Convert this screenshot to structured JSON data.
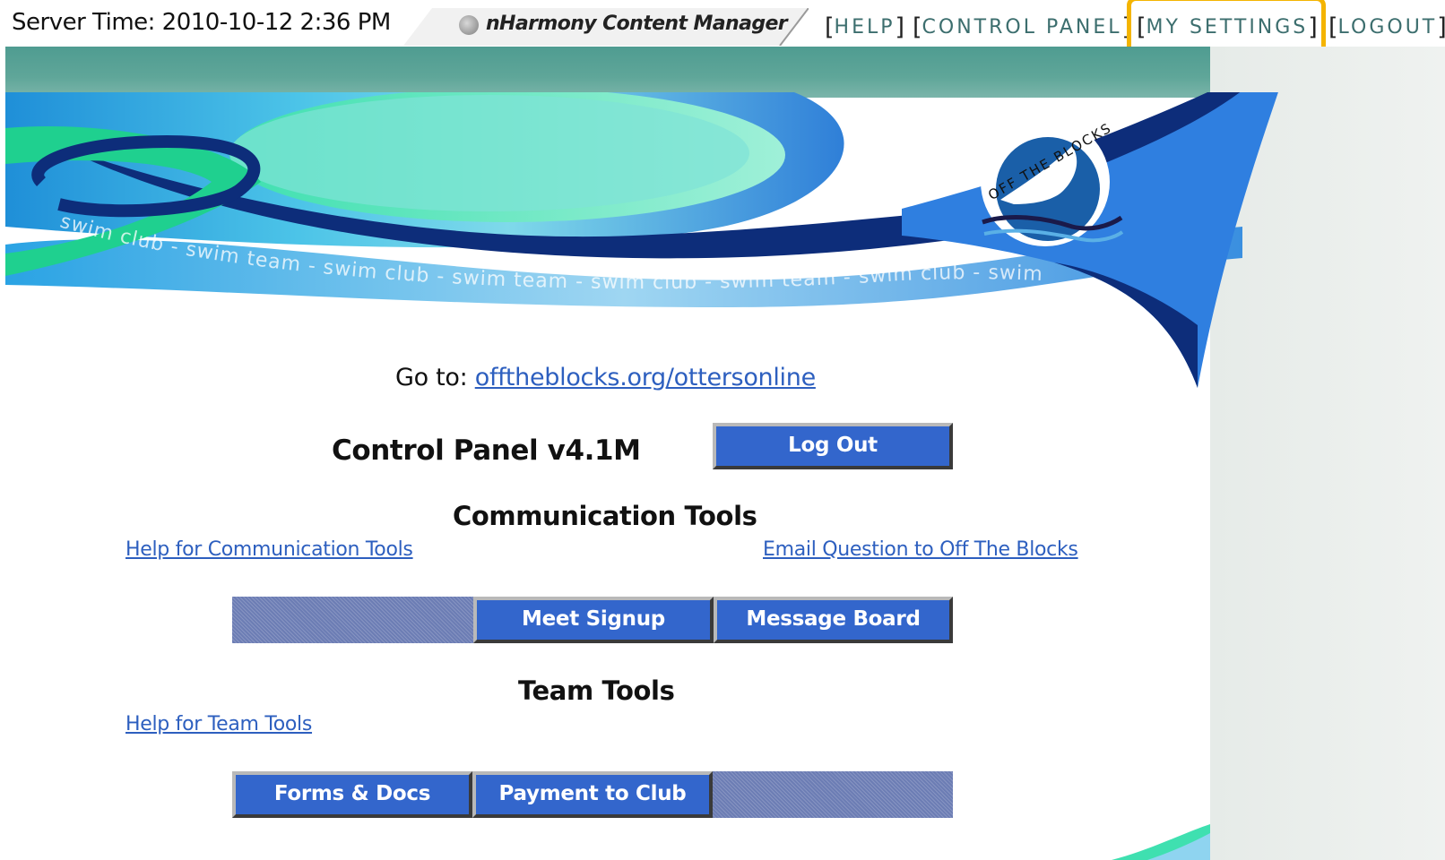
{
  "topbar": {
    "server_time": "Server Time: 2010-10-12 2:36 PM",
    "app_title": "nHarmony Content Manager",
    "nav": {
      "help": "HELP",
      "control_panel": "CONTROL PANEL",
      "my_settings": "MY SETTINGS",
      "logout": "LOGOUT"
    }
  },
  "banner": {
    "tagline_text": "swim club - swim team - swim club - swim team - swim club - swim team - swim club - swim",
    "logo_text": "OFF THE BLOCKS"
  },
  "main": {
    "goto_label": "Go to: ",
    "goto_link": "offtheblocks.org/ottersonline",
    "control_panel_title": "Control Panel v4.1M",
    "logout_button": "Log Out",
    "communication": {
      "heading": "Communication Tools",
      "help_link": "Help for Communication Tools",
      "email_link": "Email Question to Off The Blocks",
      "buttons": {
        "meet_signup": "Meet Signup",
        "message_board": "Message Board"
      }
    },
    "team": {
      "heading": "Team Tools",
      "help_link": "Help for Team Tools",
      "buttons": {
        "forms_docs": "Forms & Docs",
        "payment": "Payment to Club"
      }
    }
  },
  "colors": {
    "button_blue": "#3366cc",
    "link_blue": "#2d5fbf",
    "teal_band": "#5fa699",
    "highlight": "#f4b400"
  }
}
